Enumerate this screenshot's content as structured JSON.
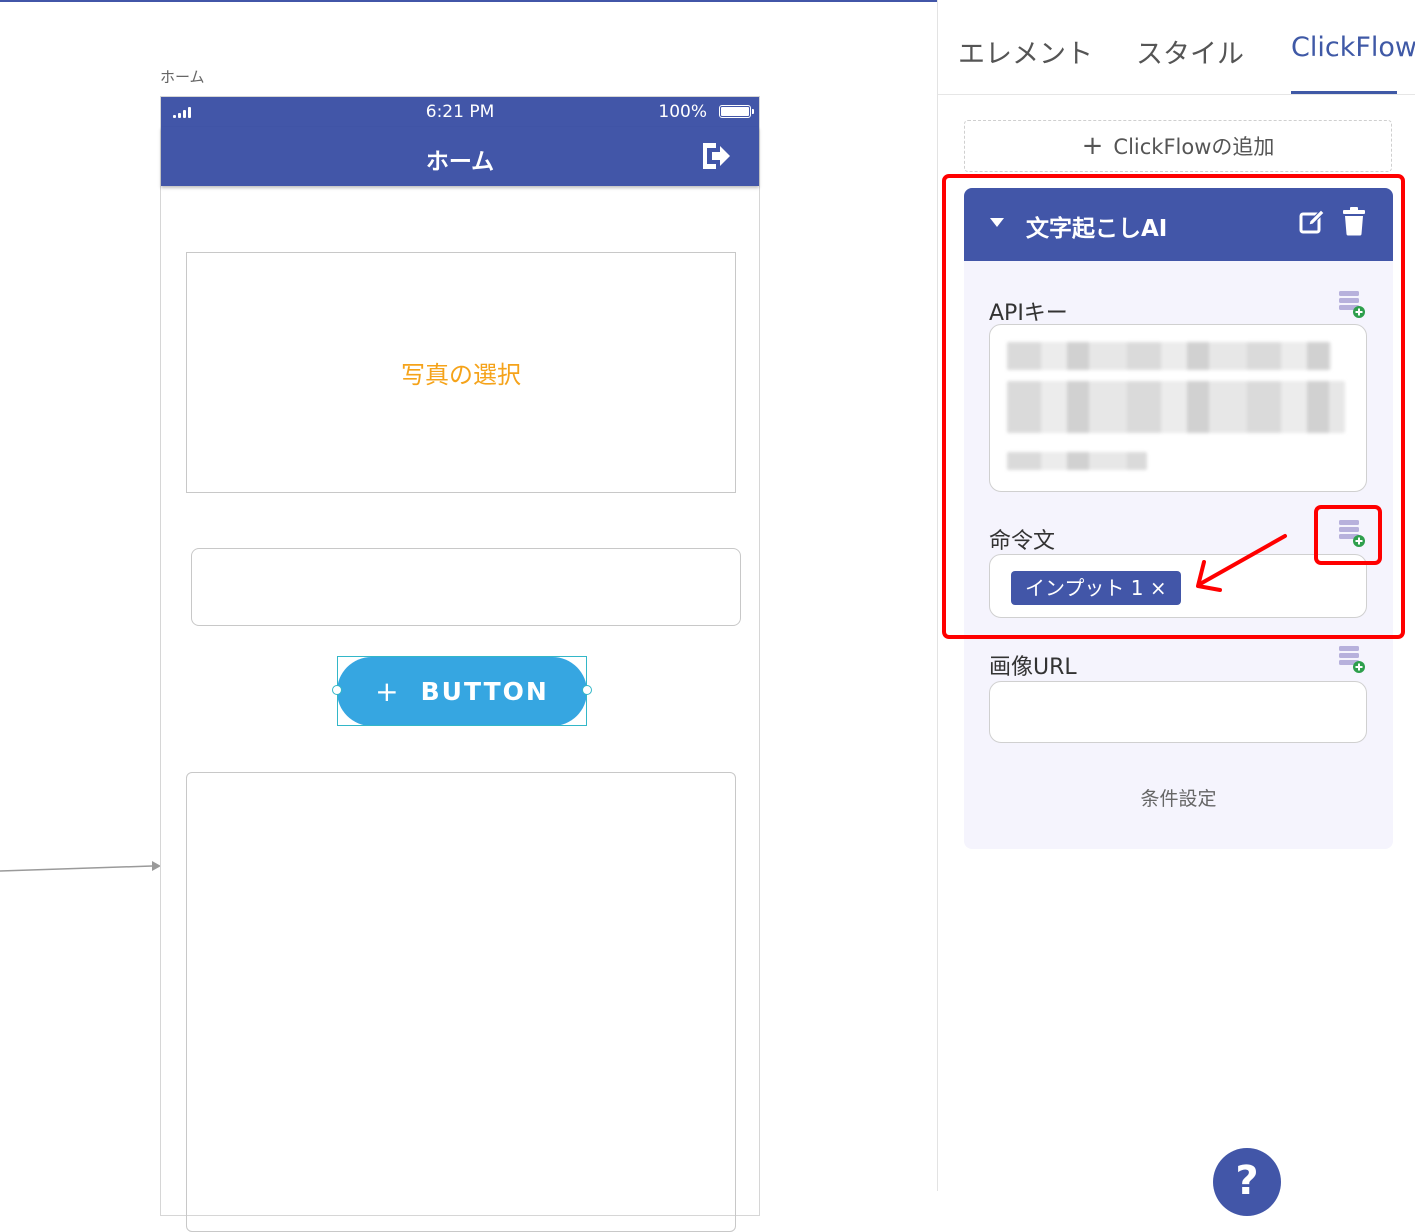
{
  "canvas": {
    "screen_caption": "ホーム"
  },
  "phone": {
    "status": {
      "time": "6:21 PM",
      "battery": "100%"
    },
    "nav": {
      "title": "ホーム"
    },
    "photo_label": "写真の選択",
    "button": {
      "plus": "+",
      "label": "BUTTON"
    }
  },
  "panel": {
    "tabs": [
      "エレメント",
      "スタイル",
      "ClickFlow"
    ],
    "active_tab": "ClickFlow",
    "add_flow": {
      "plus": "+",
      "label": "ClickFlowの追加"
    },
    "flow": {
      "title": "文字起こしAI",
      "fields": {
        "api_key_label": "APIキー",
        "prompt_label": "命令文",
        "prompt_chip": "インプット 1 ×",
        "image_url_label": "画像URL"
      },
      "conditions": "条件設定"
    },
    "help": "?"
  },
  "colors": {
    "brand": "#4256a8",
    "button": "#36a6e1",
    "photo_label": "#f5a31a",
    "annotation": "#ff0000",
    "db_icon": "#b7b1dc",
    "db_plus": "#2e9f4c"
  }
}
